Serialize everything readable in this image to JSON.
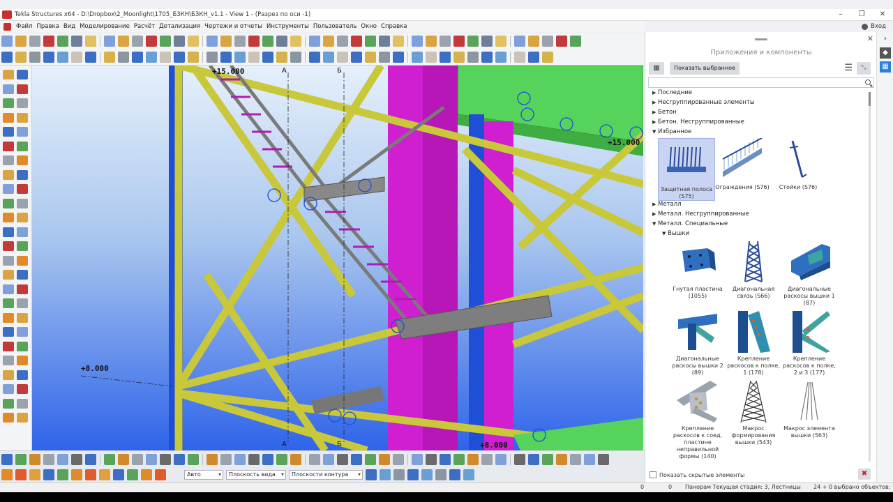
{
  "window": {
    "title": "Tekla Structures x64 - D:\\Dropbox\\2_Moonlight\\1705_БЗКН\\БЗКН_v1.1 - View 1 - (Разрез по оси -1)",
    "login_label": "Вход"
  },
  "menu": [
    "Файл",
    "Правка",
    "Вид",
    "Моделирование",
    "Расчёт",
    "Детализация",
    "Чертежи и отчеты",
    "Инструменты",
    "Пользователь",
    "Окно",
    "Справка"
  ],
  "viewport": {
    "levels": [
      "+15.000",
      "+15.000",
      "+8.000",
      "+8.000"
    ],
    "grid_labels": [
      "А",
      "Б",
      "А",
      "Б"
    ]
  },
  "panel": {
    "title": "Приложения и компоненты",
    "show_selected_label": "Показать выбранное",
    "search_placeholder": "",
    "categories": [
      {
        "label": "Последние",
        "expanded": false
      },
      {
        "label": "Несгруппированные элементы",
        "expanded": false
      },
      {
        "label": "Бетон",
        "expanded": false
      },
      {
        "label": "Бетон. Несгруппированные",
        "expanded": false
      },
      {
        "label": "Избранное",
        "expanded": true
      },
      {
        "label": "Металл",
        "expanded": false
      },
      {
        "label": "Металл. Несгруппированные",
        "expanded": false
      },
      {
        "label": "Металл. Специальные",
        "expanded": true
      },
      {
        "label": "Вышки",
        "expanded": true
      }
    ],
    "favorites": [
      {
        "label": "Защитная полоса (S75)",
        "icon": "guard-strip-icon",
        "selected": true
      },
      {
        "label": "Ограждения (S76)",
        "icon": "railing-icon",
        "selected": false
      },
      {
        "label": "Стойки (S76)",
        "icon": "post-icon",
        "selected": false
      }
    ],
    "towers": [
      {
        "label": "Гнутая пластина (1055)",
        "icon": "bent-plate-icon"
      },
      {
        "label": "Диагональная связь (S66)",
        "icon": "diagonal-brace-icon"
      },
      {
        "label": "Диагональные раскосы вышки 1 (87)",
        "icon": "tower-diagonal-1-icon"
      },
      {
        "label": "Диагональные раскосы вышки 2 (89)",
        "icon": "tower-diagonal-2-icon"
      },
      {
        "label": "Крепление раскосов к полке, 1 (178)",
        "icon": "brace-flange-1-icon"
      },
      {
        "label": "Крепление раскосов к полке, 2 и 3 (177)",
        "icon": "brace-flange-23-icon"
      },
      {
        "label": "Крепление раскосов к соед. пластине неправильной формы (140)",
        "icon": "brace-gusset-icon"
      },
      {
        "label": "Макрос формирования вышки (543)",
        "icon": "tower-macro-icon"
      },
      {
        "label": "Макрос элемента вышки (563)",
        "icon": "tower-element-macro-icon"
      }
    ],
    "show_hidden_label": "Показать скрытые элементы"
  },
  "bottom": {
    "select1": "Авто",
    "select2": "Плоскость вида",
    "select3": "Плоскости контура"
  },
  "status": {
    "num1": "0",
    "num2": "0",
    "info": "Панорам Текущая стадия: 3, Лестницы",
    "selection": "24 + 0 выбрано объектов:"
  },
  "colors": {
    "steel_yellow": "#c8c83a",
    "column_magenta": "#d01fd0",
    "column_blue": "#1f4fd6",
    "slab_green": "#56d35a",
    "sky_top": "#e6f0fb",
    "sky_bottom": "#2f64ea"
  }
}
